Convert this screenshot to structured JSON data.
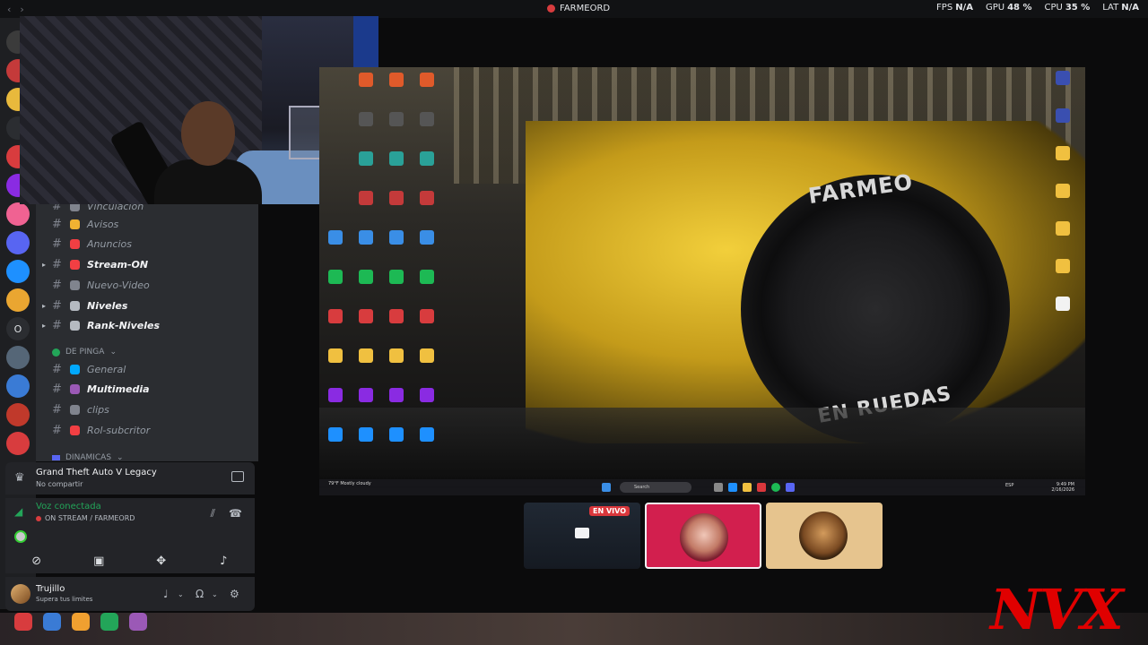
{
  "topbar": {
    "server_name": "FARMEORD",
    "stats": [
      {
        "label": "FPS",
        "value": "N/A"
      },
      {
        "label": "GPU",
        "value": "48 %"
      },
      {
        "label": "CPU",
        "value": "35 %"
      },
      {
        "label": "LAT",
        "value": "N/A"
      }
    ]
  },
  "rail": {
    "letter_server": "O",
    "colors": [
      "#3b3b3b",
      "#c43a3a",
      "#e8b93c",
      "#2b2d31",
      "#d83c3e",
      "#8a2be2",
      "#f06292",
      "#5865f2",
      "#1e90ff",
      "#eaa631",
      "#2b2d31",
      "#556677",
      "#3a7bd5",
      "#c0392b",
      "#d83c3e"
    ]
  },
  "channels": {
    "top_partial": "Vinculacion",
    "items": [
      {
        "label": "Avisos",
        "icon_color": "#f0b232",
        "bold": false
      },
      {
        "label": "Anuncios",
        "icon_color": "#f23f43",
        "bold": false
      },
      {
        "label": "Stream-ON",
        "icon_color": "#f23f43",
        "bold": true
      },
      {
        "label": "Nuevo-Video",
        "icon_color": "#80848e",
        "bold": false
      },
      {
        "label": "Niveles",
        "icon_color": "#b5bac1",
        "bold": true
      },
      {
        "label": "Rank-Niveles",
        "icon_color": "#b5bac1",
        "bold": true
      }
    ],
    "category1": "DE PINGA",
    "items2": [
      {
        "label": "General",
        "icon_color": "#00a8fc",
        "bold": false
      },
      {
        "label": "Multimedia",
        "icon_color": "#9b59b6",
        "bold": true
      },
      {
        "label": "clips",
        "icon_color": "#80848e",
        "bold": false
      },
      {
        "label": "Rol-subcritor",
        "icon_color": "#f23f43",
        "bold": false
      }
    ],
    "category2": "DINAMICAS"
  },
  "game_panel": {
    "title": "Grand Theft Auto V Legacy",
    "subtitle": "No compartir"
  },
  "voice_panel": {
    "title": "Voz conectada",
    "channel": "ON STREAM / FARMEORD"
  },
  "user_panel": {
    "name": "Trujillo",
    "status": "Supera tus limites"
  },
  "stream": {
    "tyre_top": "FARMEO",
    "tyre_bottom": "EN RUEDAS",
    "taskbar_search": "Search",
    "taskbar_weather": "79°F Mostly cloudy",
    "taskbar_lang": "ESP",
    "taskbar_time": "9:49 PM",
    "taskbar_date": "2/16/2026"
  },
  "tiles": {
    "live_label": "EN VIVO"
  },
  "logo": "NVX"
}
